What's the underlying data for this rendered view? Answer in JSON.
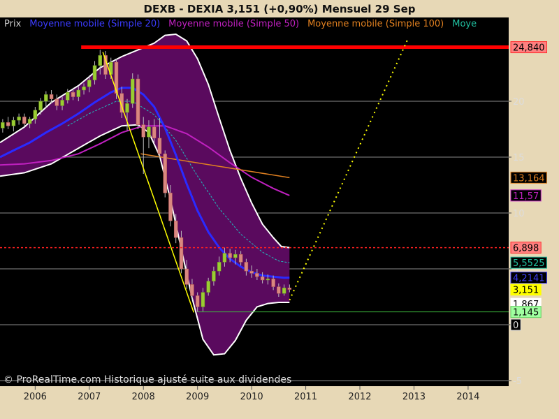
{
  "chart_data": {
    "type": "candlestick",
    "title": "DEXB - DEXIA     3,151 (+0,90%)     Mensuel  29 Sep",
    "legend": [
      {
        "label": "Prix",
        "color": "#cfcfcf"
      },
      {
        "label": "Moyenne mobile (Simple 20)",
        "color": "#3b3bff"
      },
      {
        "label": "Moyenne mobile (Simple 50)",
        "color": "#c020c0"
      },
      {
        "label": "Moyenne mobile (Simple 100)",
        "color": "#e08020"
      },
      {
        "label": "Moye",
        "color": "#20c0a0"
      }
    ],
    "copyright": "© ProRealTime.com Historique ajusté suite aux dividendes",
    "y_ticks": [
      "20",
      "15",
      "10",
      "5",
      "0",
      "-5"
    ],
    "y_tick_values": [
      20,
      15,
      10,
      5,
      0,
      -5
    ],
    "x_ticks": [
      "2006",
      "2007",
      "2008",
      "2009",
      "2010",
      "2011",
      "2012",
      "2013",
      "2014"
    ],
    "x_tick_values": [
      2006,
      2007,
      2008,
      2009,
      2010,
      2011,
      2012,
      2013,
      2014
    ],
    "ylim": [
      -5.5,
      27.5
    ],
    "xlim": [
      2005.35,
      2014.75
    ],
    "colors": {
      "grid": "#8a8a8a",
      "plot_bg": "#000000",
      "frame_bg": "#e7d8b6",
      "bollinger_fill": "#5a0a5e",
      "bollinger_edge": "#ffffff",
      "ma20": "#2a2aff",
      "ma50": "#c020c0",
      "ma100": "#e08020",
      "ma_cyan": "#20c0c0",
      "resistance": "#ff0000",
      "support": "#40c040",
      "trend": "#ffff00"
    },
    "badges": [
      {
        "text": "24,840",
        "value": 24.84,
        "bg": "#ff8080",
        "fg": "#000000",
        "border": "#ff3030"
      },
      {
        "text": "13,164",
        "value": 13.164,
        "bg": "#000000",
        "fg": "#e08020",
        "border": "#e08020"
      },
      {
        "text": "11,57",
        "value": 11.57,
        "bg": "#000000",
        "fg": "#c020c0",
        "border": "#c020c0"
      },
      {
        "text": "6,898",
        "value": 6.898,
        "bg": "#ff8080",
        "fg": "#000000",
        "border": "#ff3030"
      },
      {
        "text": "5,5525",
        "value": 5.5525,
        "bg": "#000000",
        "fg": "#20c0a0",
        "border": "#20c0a0"
      },
      {
        "text": "4,2141",
        "value": 4.2141,
        "bg": "#000000",
        "fg": "#4040ff",
        "border": "#4040ff"
      },
      {
        "text": "3,151",
        "value": 3.151,
        "bg": "#ffff00",
        "fg": "#000000",
        "border": "#ffff00"
      },
      {
        "text": "1,867",
        "value": 1.867,
        "bg": "#ffffff",
        "fg": "#000000",
        "border": "#ffffff"
      },
      {
        "text": "1,145",
        "value": 1.145,
        "bg": "#a0ffa0",
        "fg": "#000000",
        "border": "#60d060"
      },
      {
        "text": "0",
        "value": 0,
        "bg": "#000000",
        "fg": "#dddddd",
        "border": "#dddddd"
      }
    ],
    "resistance_level": 24.84,
    "support_level": 1.145,
    "dotted_level": 6.898,
    "trend_line": {
      "from": [
        2007.25,
        24.4
      ],
      "to": [
        2008.93,
        1.1
      ]
    },
    "projection_line": {
      "from": [
        2010.7,
        2.2
      ],
      "to": [
        2012.88,
        25.5
      ]
    },
    "ma100_segment": {
      "from": [
        2007.95,
        15.3
      ],
      "to": [
        2010.7,
        13.164
      ]
    },
    "ohlc": [
      [
        2005.4,
        17.6,
        18.4,
        17.2,
        18.1
      ],
      [
        2005.5,
        18.1,
        18.6,
        17.5,
        17.8
      ],
      [
        2005.6,
        17.8,
        18.6,
        17.3,
        18.3
      ],
      [
        2005.7,
        18.3,
        18.9,
        17.9,
        18.6
      ],
      [
        2005.8,
        18.6,
        18.9,
        17.8,
        18.0
      ],
      [
        2005.9,
        18.0,
        18.6,
        17.6,
        18.4
      ],
      [
        2006.0,
        18.4,
        19.5,
        18.0,
        19.2
      ],
      [
        2006.1,
        19.2,
        20.3,
        18.8,
        20.0
      ],
      [
        2006.2,
        20.0,
        20.9,
        19.4,
        20.6
      ],
      [
        2006.3,
        20.6,
        21.0,
        19.8,
        20.2
      ],
      [
        2006.4,
        20.2,
        20.6,
        19.2,
        19.6
      ],
      [
        2006.5,
        19.6,
        20.4,
        19.2,
        20.1
      ],
      [
        2006.6,
        20.1,
        21.1,
        19.8,
        20.8
      ],
      [
        2006.7,
        20.8,
        21.2,
        20.1,
        20.4
      ],
      [
        2006.8,
        20.4,
        21.3,
        20.0,
        21.0
      ],
      [
        2006.9,
        21.0,
        21.6,
        20.6,
        21.3
      ],
      [
        2007.0,
        21.3,
        22.3,
        20.8,
        21.9
      ],
      [
        2007.1,
        21.9,
        23.6,
        21.5,
        23.2
      ],
      [
        2007.2,
        23.2,
        24.6,
        22.4,
        24.1
      ],
      [
        2007.3,
        24.1,
        24.5,
        22.0,
        22.4
      ],
      [
        2007.4,
        22.4,
        23.9,
        22.0,
        23.5
      ],
      [
        2007.5,
        23.5,
        23.8,
        20.2,
        20.7
      ],
      [
        2007.6,
        20.7,
        21.3,
        18.5,
        19.0
      ],
      [
        2007.7,
        19.0,
        20.2,
        17.4,
        19.8
      ],
      [
        2007.8,
        19.8,
        22.5,
        19.4,
        22.0
      ],
      [
        2007.9,
        22.0,
        22.4,
        17.5,
        17.9
      ],
      [
        2008.0,
        17.9,
        18.6,
        13.5,
        16.8
      ],
      [
        2008.1,
        16.8,
        18.3,
        15.8,
        17.7
      ],
      [
        2008.2,
        17.7,
        18.4,
        16.2,
        16.7
      ],
      [
        2008.3,
        16.7,
        18.5,
        15.0,
        15.3
      ],
      [
        2008.4,
        15.3,
        15.6,
        11.4,
        11.8
      ],
      [
        2008.5,
        11.8,
        12.5,
        8.8,
        9.3
      ],
      [
        2008.6,
        9.3,
        9.9,
        7.3,
        7.8
      ],
      [
        2008.7,
        7.8,
        8.4,
        4.6,
        5.0
      ],
      [
        2008.8,
        5.0,
        5.8,
        3.2,
        3.6
      ],
      [
        2008.9,
        3.6,
        4.1,
        2.2,
        2.6
      ],
      [
        2009.0,
        2.6,
        2.9,
        1.15,
        1.6
      ],
      [
        2009.1,
        1.6,
        3.3,
        1.2,
        2.9
      ],
      [
        2009.2,
        2.9,
        4.2,
        2.6,
        3.9
      ],
      [
        2009.3,
        3.9,
        5.2,
        3.5,
        4.8
      ],
      [
        2009.4,
        4.8,
        6.1,
        4.4,
        5.6
      ],
      [
        2009.5,
        5.6,
        6.9,
        5.2,
        6.4
      ],
      [
        2009.6,
        6.4,
        6.8,
        5.6,
        6.0
      ],
      [
        2009.7,
        6.0,
        6.7,
        5.4,
        6.3
      ],
      [
        2009.8,
        6.3,
        6.6,
        5.3,
        5.6
      ],
      [
        2009.9,
        5.6,
        5.9,
        4.4,
        4.8
      ],
      [
        2010.0,
        4.8,
        5.3,
        4.2,
        4.6
      ],
      [
        2010.1,
        4.6,
        5.0,
        4.0,
        4.3
      ],
      [
        2010.2,
        4.3,
        4.7,
        3.7,
        4.0
      ],
      [
        2010.3,
        4.0,
        4.5,
        3.6,
        4.1
      ],
      [
        2010.4,
        4.1,
        4.4,
        3.1,
        3.4
      ],
      [
        2010.5,
        3.4,
        3.7,
        2.5,
        2.8
      ],
      [
        2010.6,
        2.8,
        3.6,
        2.6,
        3.3
      ],
      [
        2010.7,
        3.3,
        3.6,
        2.9,
        3.151
      ]
    ],
    "ma20": [
      [
        2005.35,
        15.0
      ],
      [
        2005.6,
        15.6
      ],
      [
        2005.9,
        16.3
      ],
      [
        2006.2,
        17.2
      ],
      [
        2006.5,
        18.0
      ],
      [
        2006.8,
        18.9
      ],
      [
        2007.1,
        19.9
      ],
      [
        2007.4,
        20.8
      ],
      [
        2007.6,
        21.2
      ],
      [
        2007.8,
        21.2
      ],
      [
        2008.0,
        20.6
      ],
      [
        2008.2,
        19.5
      ],
      [
        2008.4,
        17.6
      ],
      [
        2008.6,
        15.2
      ],
      [
        2008.8,
        12.6
      ],
      [
        2009.0,
        10.2
      ],
      [
        2009.2,
        8.3
      ],
      [
        2009.4,
        6.9
      ],
      [
        2009.6,
        5.9
      ],
      [
        2009.8,
        5.2
      ],
      [
        2010.0,
        4.7
      ],
      [
        2010.2,
        4.4
      ],
      [
        2010.4,
        4.3
      ],
      [
        2010.6,
        4.2
      ],
      [
        2010.7,
        4.2141
      ]
    ],
    "ma50": [
      [
        2005.35,
        14.3
      ],
      [
        2005.8,
        14.4
      ],
      [
        2006.3,
        14.7
      ],
      [
        2006.8,
        15.3
      ],
      [
        2007.2,
        16.2
      ],
      [
        2007.6,
        17.2
      ],
      [
        2008.0,
        17.8
      ],
      [
        2008.4,
        17.8
      ],
      [
        2008.8,
        17.1
      ],
      [
        2009.2,
        15.9
      ],
      [
        2009.6,
        14.5
      ],
      [
        2010.0,
        13.2
      ],
      [
        2010.4,
        12.2
      ],
      [
        2010.7,
        11.57
      ]
    ],
    "ma_cyan": [
      [
        2006.6,
        17.8
      ],
      [
        2007.0,
        18.9
      ],
      [
        2007.5,
        20.0
      ],
      [
        2007.8,
        20.0
      ],
      [
        2008.2,
        18.8
      ],
      [
        2008.6,
        16.5
      ],
      [
        2009.0,
        13.3
      ],
      [
        2009.4,
        10.4
      ],
      [
        2009.8,
        8.1
      ],
      [
        2010.2,
        6.5
      ],
      [
        2010.5,
        5.7
      ],
      [
        2010.7,
        5.5525
      ]
    ],
    "bollinger_upper": [
      [
        2005.35,
        16.3
      ],
      [
        2005.8,
        17.7
      ],
      [
        2006.3,
        19.9
      ],
      [
        2006.8,
        21.4
      ],
      [
        2007.2,
        23.0
      ],
      [
        2007.6,
        24.0
      ],
      [
        2007.9,
        24.6
      ],
      [
        2008.2,
        25.2
      ],
      [
        2008.4,
        25.9
      ],
      [
        2008.6,
        26.0
      ],
      [
        2008.8,
        25.4
      ],
      [
        2009.0,
        23.8
      ],
      [
        2009.2,
        21.5
      ],
      [
        2009.4,
        18.5
      ],
      [
        2009.6,
        15.6
      ],
      [
        2009.8,
        13.1
      ],
      [
        2010.0,
        10.9
      ],
      [
        2010.2,
        9.0
      ],
      [
        2010.4,
        7.8
      ],
      [
        2010.55,
        7.0
      ],
      [
        2010.7,
        6.9
      ]
    ],
    "bollinger_lower": [
      [
        2005.35,
        13.3
      ],
      [
        2005.8,
        13.6
      ],
      [
        2006.3,
        14.4
      ],
      [
        2006.8,
        15.8
      ],
      [
        2007.2,
        16.9
      ],
      [
        2007.6,
        17.8
      ],
      [
        2007.9,
        17.9
      ],
      [
        2008.1,
        17.2
      ],
      [
        2008.3,
        15.1
      ],
      [
        2008.5,
        11.2
      ],
      [
        2008.7,
        6.8
      ],
      [
        2008.9,
        2.4
      ],
      [
        2009.1,
        -1.3
      ],
      [
        2009.3,
        -2.7
      ],
      [
        2009.5,
        -2.6
      ],
      [
        2009.7,
        -1.4
      ],
      [
        2009.9,
        0.4
      ],
      [
        2010.1,
        1.6
      ],
      [
        2010.3,
        1.9
      ],
      [
        2010.5,
        2.0
      ],
      [
        2010.7,
        2.0
      ]
    ]
  }
}
